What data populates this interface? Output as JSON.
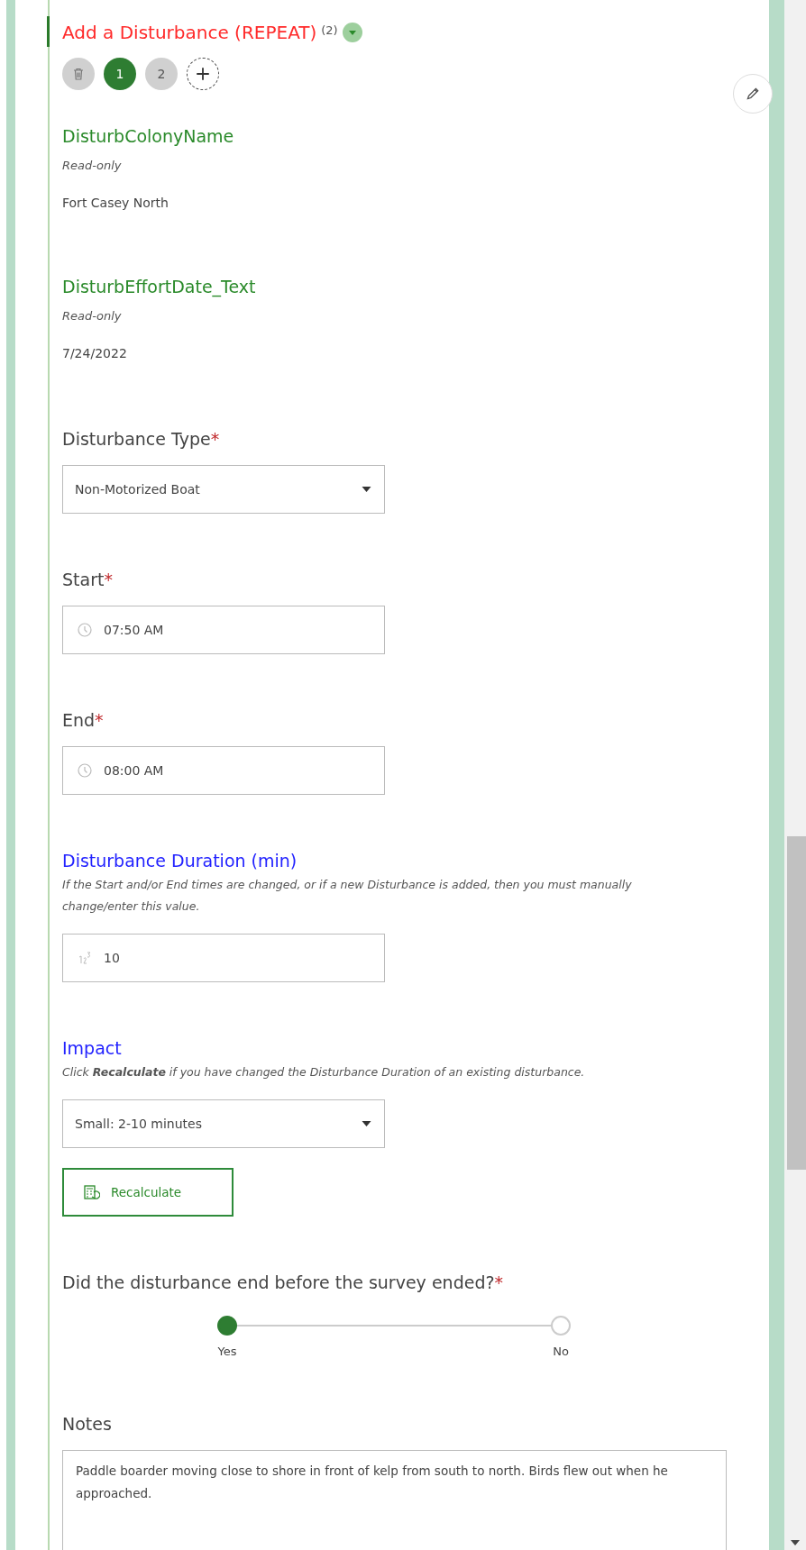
{
  "repeat": {
    "title": "Add a Disturbance (REPEAT)",
    "count": "(2)",
    "expanded": true,
    "records": [
      {
        "label": "1",
        "selected": true
      },
      {
        "label": "2",
        "selected": false
      }
    ]
  },
  "fields": [
    {
      "kind": "readonly",
      "label": "DisturbColonyName",
      "hint": "Read-only",
      "value": "Fort Casey North"
    },
    {
      "kind": "readonly",
      "label": "DisturbEffortDate_Text",
      "hint": "Read-only",
      "value": "7/24/2022"
    },
    {
      "kind": "select",
      "label": "Disturbance Type",
      "required_mark": "*",
      "value": "Non-Motorized Boat"
    },
    {
      "kind": "time",
      "label": "Start",
      "required_mark": "*",
      "value": "07:50 AM"
    },
    {
      "kind": "time",
      "label": "End",
      "required_mark": "*",
      "value": "08:00 AM"
    },
    {
      "kind": "number",
      "label": "Disturbance Duration (min)",
      "color": "#2222ff",
      "hint": "If the Start and/or End times are changed, or if a new Disturbance is added, then you must manually change/enter this value.",
      "value": "10"
    },
    {
      "kind": "select",
      "label": "Impact",
      "color": "#2222ff",
      "hint": "Click **Recalculate** if you have changed the Disturbance Duration of an existing disturbance.",
      "value": "Small: 2-10 minutes",
      "button": "Recalculate"
    },
    {
      "kind": "radio",
      "label": "Did the disturbance end before the survey ended?",
      "required_mark": "*",
      "options": [
        {
          "label": "Yes",
          "selected": true
        },
        {
          "label": "No",
          "selected": false
        }
      ]
    },
    {
      "kind": "textarea",
      "label": "Notes",
      "value": "Paddle boarder moving close to shore in front of kelp from south to north. Birds flew out when he approached."
    }
  ]
}
